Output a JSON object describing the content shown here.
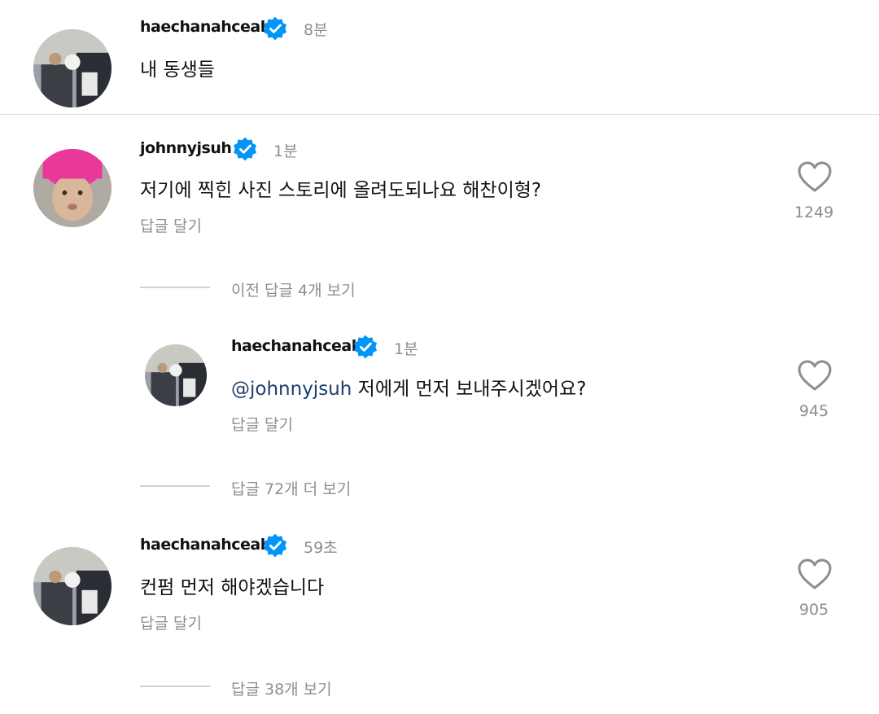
{
  "caption": {
    "username": "haechanahceah",
    "time": "8분",
    "text": "내 동생들"
  },
  "comments": [
    {
      "username": "johnnyjsuh",
      "time": "1분",
      "text": "저기에 찍힌 사진 스토리에 올려도되나요 해찬이형?",
      "reply_label": "답글 달기",
      "likes": "1249"
    },
    {
      "username": "haechanahceah",
      "time": "1분",
      "mention": "@johnnyjsuh",
      "text": " 저에게 먼저 보내주시겠어요?",
      "reply_label": "답글 달기",
      "likes": "945"
    },
    {
      "username": "haechanahceah",
      "time": "59초",
      "text": "컨펌 먼저 해야겠습니다",
      "reply_label": "답글 달기",
      "likes": "905"
    }
  ],
  "threads": {
    "view_previous": "이전 답글 4개 보기",
    "view_more": "답글 72개 더 보기",
    "view_replies": "답글 38개 보기"
  },
  "colors": {
    "verified": "#0095f6",
    "muted_text": "#8e8e8e",
    "mention": "#1c3f6e",
    "beanie": "#e8389a"
  }
}
